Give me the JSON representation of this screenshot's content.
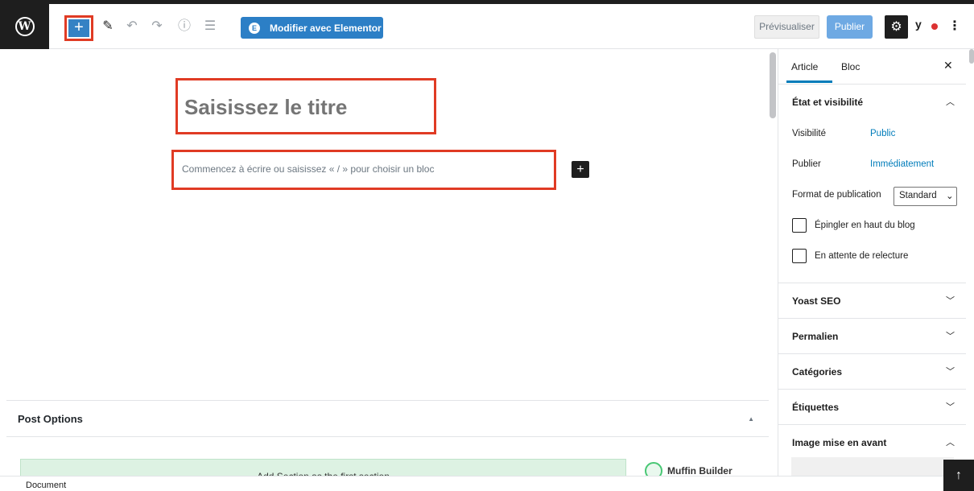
{
  "toolbar": {
    "add_block_label": "+",
    "elementor_label": "Modifier avec Elementor",
    "preview_label": "Prévisualiser",
    "publish_label": "Publier",
    "icons": [
      "wordpress-logo-icon",
      "plus-icon",
      "pencil-icon",
      "undo-icon",
      "redo-icon",
      "info-icon",
      "outline-icon",
      "elementor-icon",
      "gear-icon",
      "yoast-icon",
      "more-vertical-icon"
    ]
  },
  "editor": {
    "title_placeholder": "Saisissez le titre",
    "paragraph_placeholder": "Commencez à écrire ou saisissez « / » pour choisir un bloc"
  },
  "post_options": {
    "title": "Post Options",
    "add_section_label": "Add Section",
    "add_section_suffix": "as the first section",
    "muffin_label": "Muffin Builder"
  },
  "sidebar": {
    "tabs": [
      "Article",
      "Bloc"
    ],
    "status_panel": {
      "title": "État et visibilité",
      "visibility_label": "Visibilité",
      "visibility_value": "Public",
      "publish_label": "Publier",
      "publish_value": "Immédiatement",
      "format_label": "Format de publication",
      "format_value": "Standard",
      "pin_label": "Épingler en haut du blog",
      "review_label": "En attente de relecture"
    },
    "panels": [
      "Yoast SEO",
      "Permalien",
      "Catégories",
      "Étiquettes",
      "Image mise en avant"
    ]
  },
  "footer": {
    "breadcrumb": "Document"
  },
  "colors": {
    "accent": "#007cba",
    "highlight_border": "#e03b24",
    "elementor": "#2c7fc6"
  }
}
